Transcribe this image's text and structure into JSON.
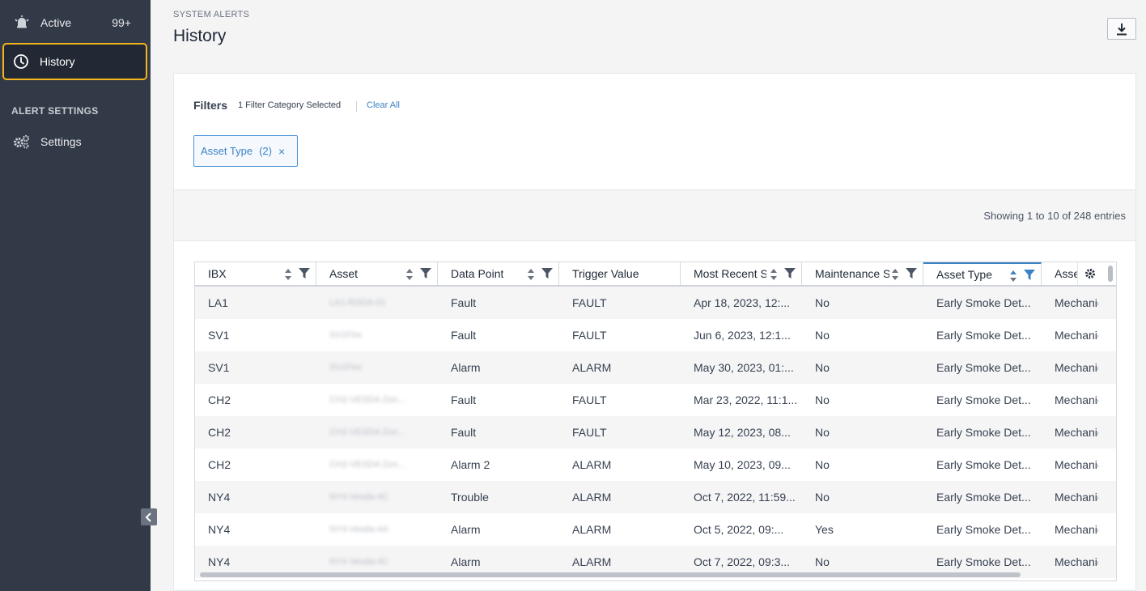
{
  "sidebar": {
    "items": [
      {
        "label": "Active",
        "badge": "99+",
        "icon": "alarm-bell-icon"
      },
      {
        "label": "History",
        "icon": "clock-icon"
      }
    ],
    "section_label": "ALERT SETTINGS",
    "settings": {
      "label": "Settings",
      "icon": "gears-icon"
    }
  },
  "header": {
    "breadcrumb": "SYSTEM ALERTS",
    "title": "History"
  },
  "filters": {
    "label": "Filters",
    "count_text": "1 Filter Category Selected",
    "clear_all": "Clear All",
    "chip": {
      "label": "Asset Type",
      "count": "(2)",
      "remove": "×"
    }
  },
  "showing_text": "Showing 1 to 10 of 248 entries",
  "table": {
    "columns": [
      {
        "label": "IBX"
      },
      {
        "label": "Asset"
      },
      {
        "label": "Data Point"
      },
      {
        "label": "Trigger Value"
      },
      {
        "label": "Most Recent S"
      },
      {
        "label": "Maintenance S"
      },
      {
        "label": "Asset Type"
      },
      {
        "label": "Asse"
      }
    ],
    "rows": [
      [
        "LA1",
        "LA1-RSDA-01",
        "Fault",
        "FAULT",
        "Apr 18, 2023, 12:...",
        "No",
        "Early Smoke Det...",
        "Mechanic"
      ],
      [
        "SV1",
        "SV1Fire",
        "Fault",
        "FAULT",
        "Jun 6, 2023, 12:1...",
        "No",
        "Early Smoke Det...",
        "Mechanic"
      ],
      [
        "SV1",
        "SV1Fire",
        "Alarm",
        "ALARM",
        "May 30, 2023, 01:...",
        "No",
        "Early Smoke Det...",
        "Mechanic"
      ],
      [
        "CH2",
        "CH2-VESDA Zon...",
        "Fault",
        "FAULT",
        "Mar 23, 2022, 11:1...",
        "No",
        "Early Smoke Det...",
        "Mechanic"
      ],
      [
        "CH2",
        "CH2-VESDA Zon...",
        "Fault",
        "FAULT",
        "May 12, 2023, 08...",
        "No",
        "Early Smoke Det...",
        "Mechanic"
      ],
      [
        "CH2",
        "CH2-VESDA Zon...",
        "Alarm 2",
        "ALARM",
        "May 10, 2023, 09...",
        "No",
        "Early Smoke Det...",
        "Mechanic"
      ],
      [
        "NY4",
        "NY4-Vesda-4C",
        "Trouble",
        "ALARM",
        "Oct 7, 2022, 11:59...",
        "No",
        "Early Smoke Det...",
        "Mechanic"
      ],
      [
        "NY4",
        "NY4-Vesda-4A",
        "Alarm",
        "ALARM",
        "Oct 5, 2022, 09:...",
        "Yes",
        "Early Smoke Det...",
        "Mechanic"
      ],
      [
        "NY4",
        "NY4-Vesda-4C",
        "Alarm",
        "ALARM",
        "Oct 7, 2022, 09:3...",
        "No",
        "Early Smoke Det...",
        "Mechanic"
      ]
    ]
  },
  "colors": {
    "sidebar_bg": "#333a47",
    "highlight": "#f2b51b",
    "accent": "#3b82c4"
  }
}
